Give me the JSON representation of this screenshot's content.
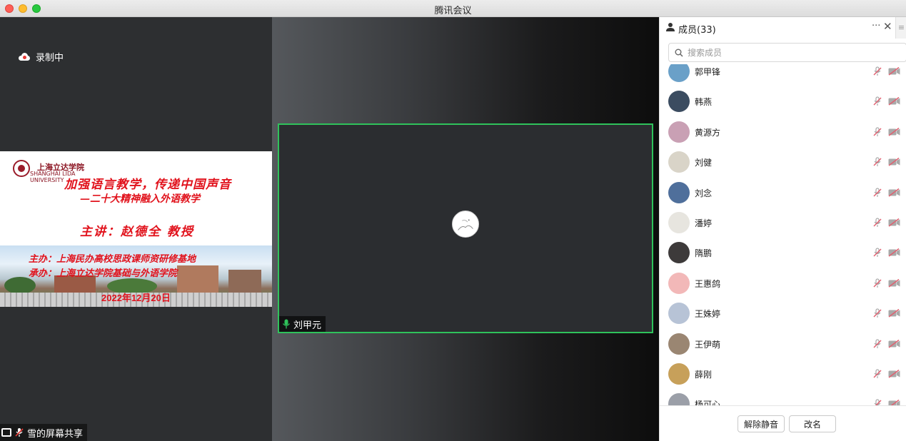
{
  "window": {
    "title": "腾讯会议"
  },
  "recording": {
    "label": "录制中"
  },
  "slide": {
    "school_cn": "上海立达学院",
    "school_en_line1": "SHANGHAI LIDA",
    "school_en_line2": "UNIVERSITY",
    "title": "加强语言教学，传递中国声音",
    "subtitle": "—二十大精神融入外语教学",
    "speaker": "主讲：赵德全 教授",
    "organizer": "主办：上海民办高校思政课师资研修基地",
    "co_organizer": "承办：上海立达学院基础与外语学院",
    "date": "2022年12月20日"
  },
  "screen_share": {
    "label": "雪的屏幕共享"
  },
  "active_speaker": {
    "name": "刘甲元"
  },
  "sidebar": {
    "title": "成员(33)",
    "more": "···",
    "close": "✕",
    "collapse": "≡",
    "search_placeholder": "搜索成员",
    "members": [
      {
        "name": "郭甲锋",
        "avatar_color": "#6aa0c8"
      },
      {
        "name": "韩燕",
        "avatar_color": "#3b4c60"
      },
      {
        "name": "黄源方",
        "avatar_color": "#c9a0b4"
      },
      {
        "name": "刘健",
        "avatar_color": "#d9d4c8"
      },
      {
        "name": "刘念",
        "avatar_color": "#4f6f9b"
      },
      {
        "name": "潘婷",
        "avatar_color": "#e7e5df"
      },
      {
        "name": "隋鹏",
        "avatar_color": "#3d3a3a"
      },
      {
        "name": "王惠鸽",
        "avatar_color": "#f2b8b8"
      },
      {
        "name": "王姝婷",
        "avatar_color": "#b7c3d6"
      },
      {
        "name": "王伊萌",
        "avatar_color": "#9a8672"
      },
      {
        "name": "薛刚",
        "avatar_color": "#c7a05a"
      },
      {
        "name": "杨可心",
        "avatar_color": "#9b9fa8"
      }
    ],
    "buttons": {
      "unmute_all": "解除静音",
      "rename": "改名"
    }
  },
  "colors": {
    "active_border": "#2fc25b",
    "muted_icon": "#e06070",
    "slide_text": "#e1121c"
  }
}
